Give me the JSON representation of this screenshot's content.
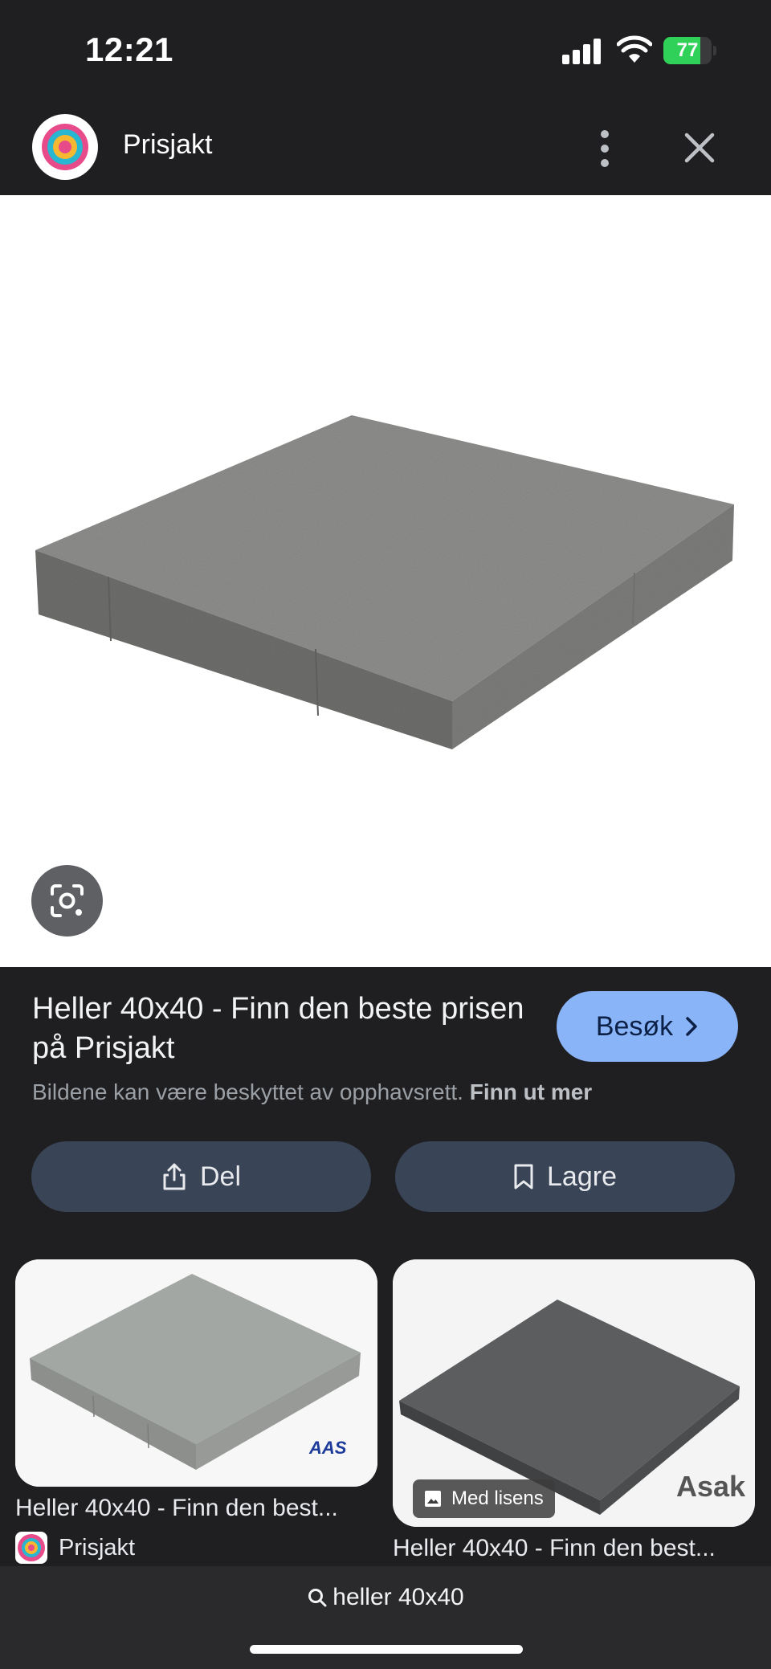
{
  "status_bar": {
    "time": "12:21",
    "battery_label": "77",
    "battery_level": 0.77
  },
  "header": {
    "site_name": "Prisjakt",
    "logo_icon": "prisjakt-logo",
    "more_icon": "more-vert-icon",
    "close_icon": "close-icon"
  },
  "main_image": {
    "subject": "concrete paving slab",
    "lens_icon": "google-lens-icon"
  },
  "result": {
    "title": "Heller 40x40 - Finn den beste prisen på Prisjakt",
    "visit_label": "Besøk",
    "copyright_text": "Bildene kan være beskyttet av opphavsrett.",
    "copyright_link": "Finn ut mer"
  },
  "actions": {
    "share_label": "Del",
    "save_label": "Lagre"
  },
  "related": [
    {
      "title": "Heller 40x40 - Finn den best...",
      "source": "Prisjakt",
      "brand": "AAS"
    },
    {
      "title": "Heller 40x40 - Finn den best...",
      "badge": "Med lisens",
      "brand": "Asak"
    }
  ],
  "search_bar": {
    "query": "heller 40x40"
  },
  "colors": {
    "background": "#1f1f21",
    "visit_button": "#8ab4f8",
    "action_button": "#394457",
    "battery": "#30d158"
  }
}
